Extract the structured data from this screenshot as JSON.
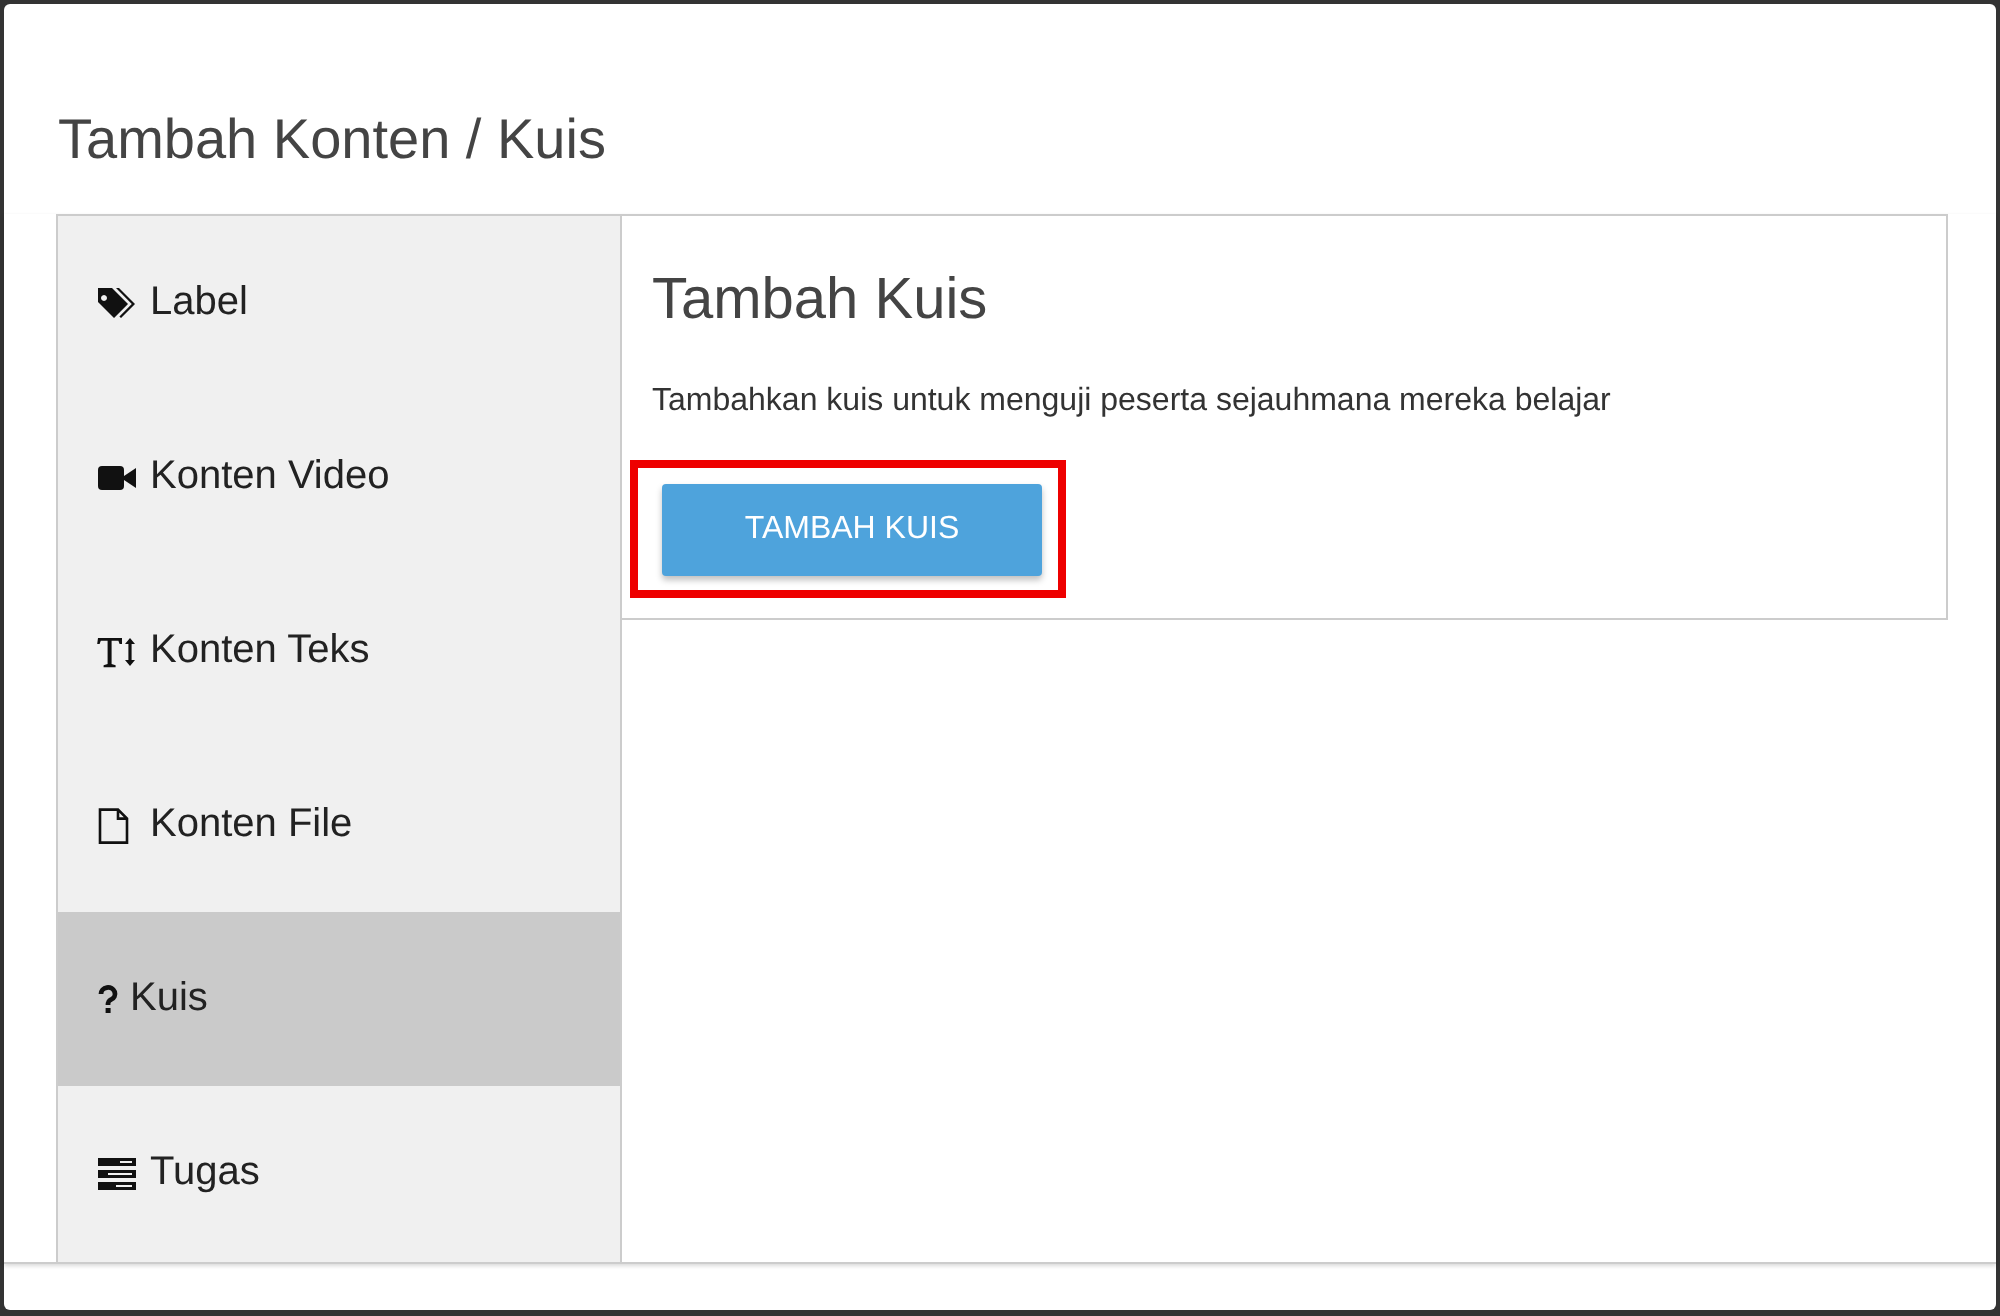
{
  "dialog": {
    "title": "Tambah Konten / Kuis"
  },
  "sidebar": {
    "items": [
      {
        "label": "Label",
        "selected": false
      },
      {
        "label": "Konten Video",
        "selected": false
      },
      {
        "label": "Konten Teks",
        "selected": false
      },
      {
        "label": "Konten File",
        "selected": false
      },
      {
        "label": "Kuis",
        "selected": true
      },
      {
        "label": "Tugas",
        "selected": false
      }
    ]
  },
  "panel": {
    "heading": "Tambah Kuis",
    "description": "Tambahkan kuis untuk menguji peserta sejauhmana mereka belajar",
    "button": {
      "label": "TAMBAH KUIS",
      "highlighted": true
    }
  }
}
